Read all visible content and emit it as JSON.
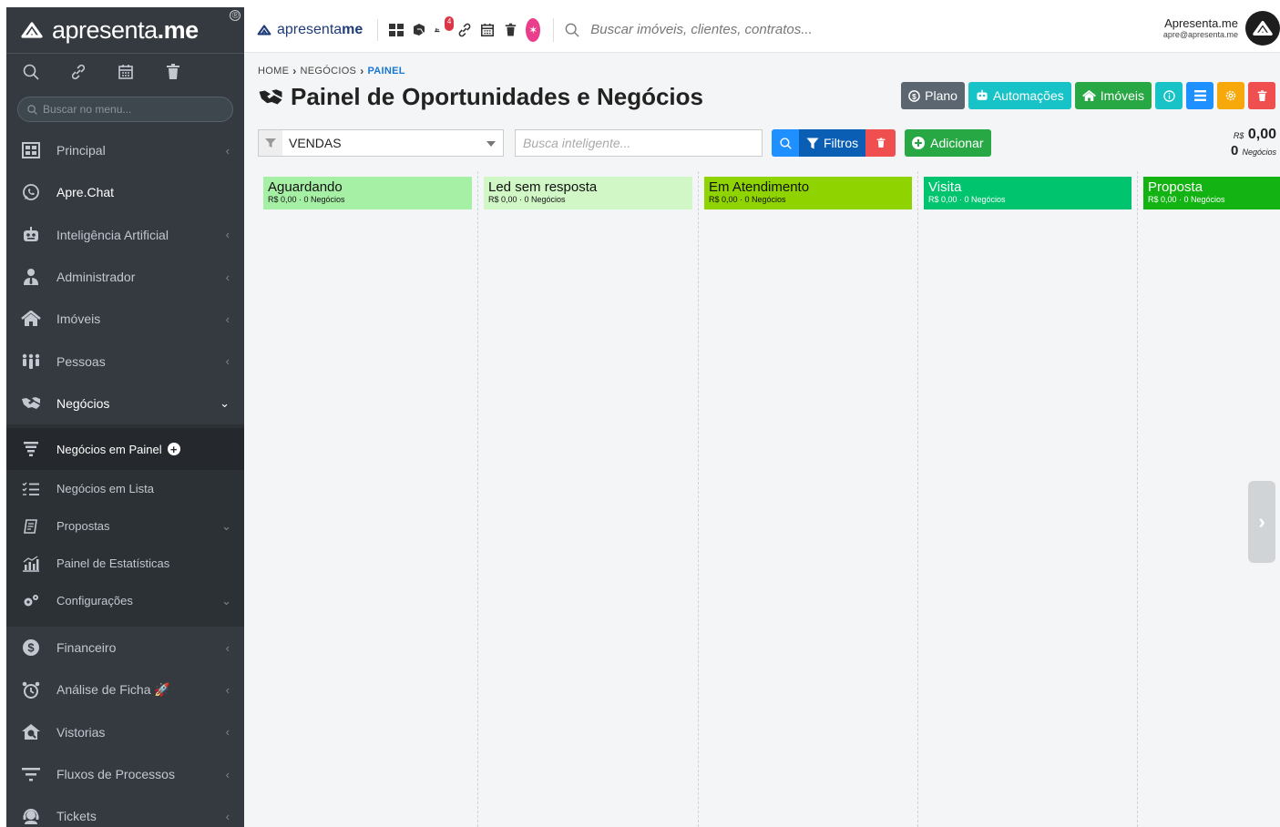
{
  "brand": {
    "name_light": "apresenta",
    "name_dot": ".",
    "name_bold": "me",
    "reg_mark": "®"
  },
  "sidebar": {
    "search_placeholder": "Buscar no menu...",
    "items": [
      {
        "label": "Principal",
        "icon": "grid-icon"
      },
      {
        "label": "Apre.Chat",
        "icon": "whatsapp-icon"
      },
      {
        "label": "Inteligência Artificial",
        "icon": "robot-icon"
      },
      {
        "label": "Administrador",
        "icon": "user-tie-icon"
      },
      {
        "label": "Imóveis",
        "icon": "home-icon"
      },
      {
        "label": "Pessoas",
        "icon": "people-icon"
      },
      {
        "label": "Negócios",
        "icon": "handshake-icon"
      }
    ],
    "sub_items": [
      {
        "label": "Negócios em Painel",
        "icon": "funnel-icon"
      },
      {
        "label": "Negócios em Lista",
        "icon": "list-check-icon"
      },
      {
        "label": "Propostas",
        "icon": "contract-icon"
      },
      {
        "label": "Painel de Estatísticas",
        "icon": "chart-icon"
      },
      {
        "label": "Configurações",
        "icon": "cogs-icon"
      }
    ],
    "items_after": [
      {
        "label": "Financeiro",
        "icon": "dollar-icon"
      },
      {
        "label": "Análise de Ficha 🚀",
        "icon": "alarm-icon"
      },
      {
        "label": "Vistorias",
        "icon": "house-check-icon"
      },
      {
        "label": "Fluxos de Processos",
        "icon": "filter-icon"
      },
      {
        "label": "Tickets",
        "icon": "headset-icon"
      }
    ]
  },
  "topbar": {
    "logo_light": "apresenta",
    "logo_bold": "me",
    "notification_count": "4",
    "search_placeholder": "Buscar imóveis, clientes, contratos...",
    "user_name": "Apresenta.me",
    "user_email": "apre@apresenta.me"
  },
  "breadcrumb": {
    "home": "HOME",
    "section": "NEGÓCIOS",
    "current": "PAINEL"
  },
  "page": {
    "title_light": "Painel de",
    "title_bold": "Oportunidades e Negócios"
  },
  "actions": {
    "plano": "Plano",
    "automacoes": "Automações",
    "imoveis": "Imóveis"
  },
  "filters": {
    "pipeline_value": "VENDAS",
    "smart_search_placeholder": "Busca inteligente...",
    "filters_label": "Filtros",
    "add_label": "Adicionar"
  },
  "totals": {
    "currency": "R$",
    "amount": "0,00",
    "count": "0",
    "count_label": "Negócios"
  },
  "columns": [
    {
      "title": "Aguardando",
      "subtitle": "R$ 0,00 · 0 Negócios",
      "color": "#a6f0a6"
    },
    {
      "title": "Led sem resposta",
      "subtitle": "R$ 0,00 · 0 Negócios",
      "color": "#d2f7c6"
    },
    {
      "title": "Em Atendimento",
      "subtitle": "R$ 0,00 · 0 Negócios",
      "color": "#8fd400"
    },
    {
      "title": "Visita",
      "subtitle": "R$ 0,00 · 0 Negócios",
      "color": "#00c46e"
    },
    {
      "title": "Proposta",
      "subtitle": "R$ 0,00 · 0 Negócios",
      "color": "#12b312"
    }
  ]
}
